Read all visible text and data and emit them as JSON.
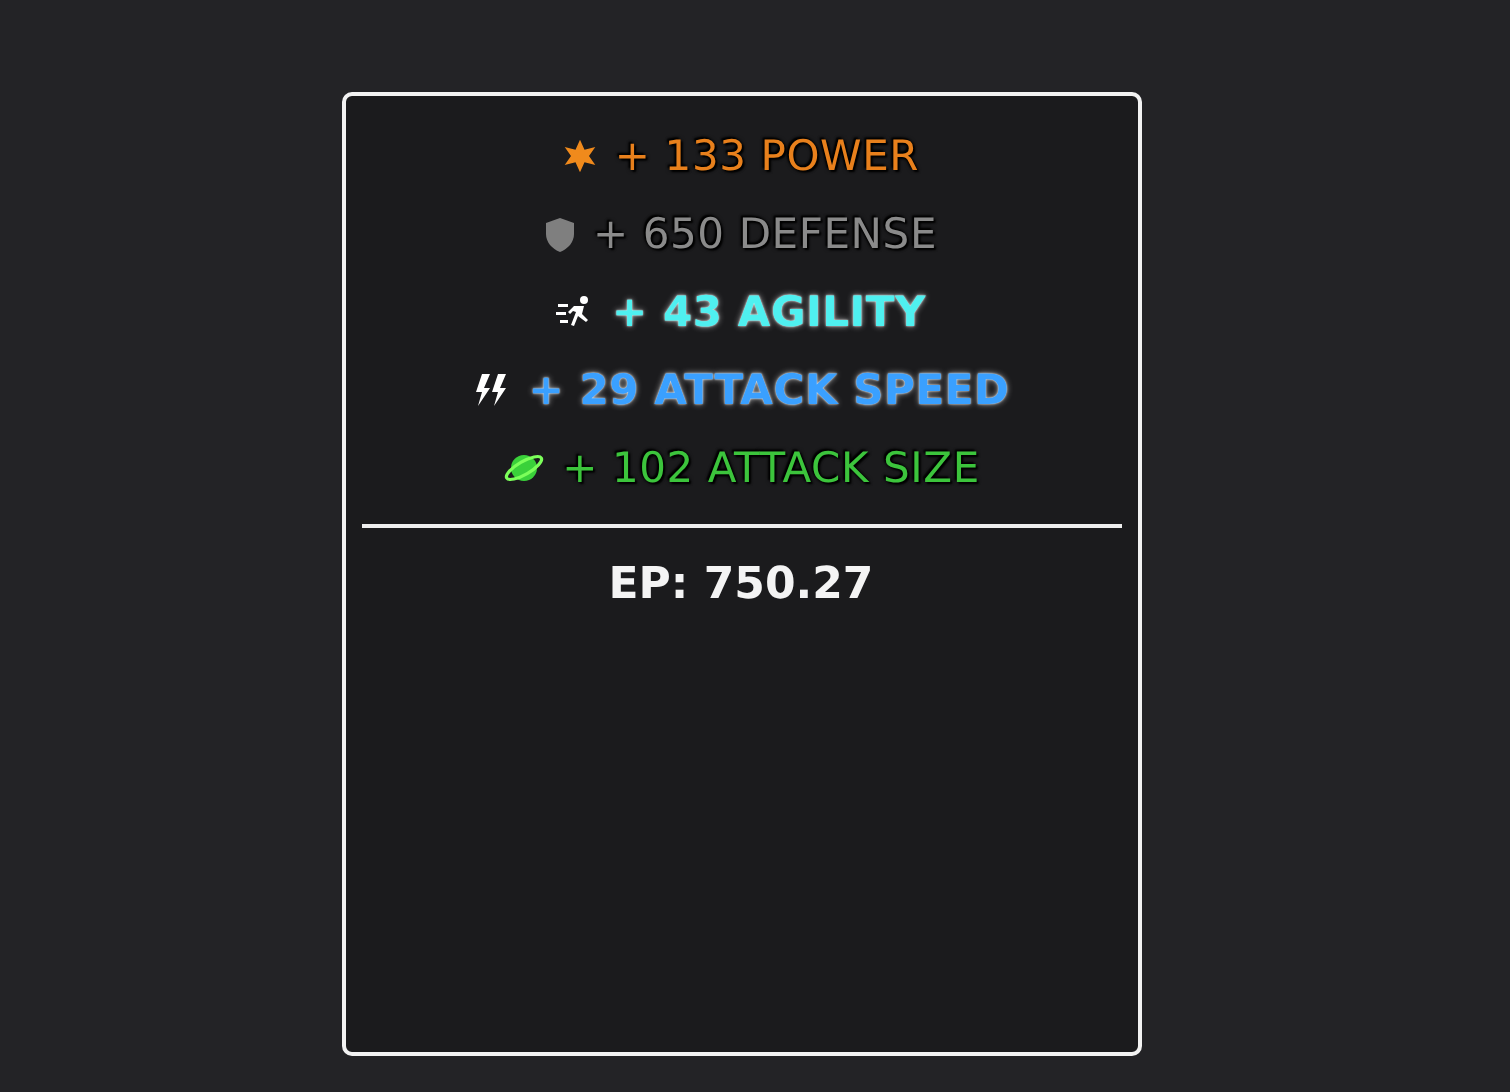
{
  "stats": [
    {
      "kind": "power",
      "text": "+ 133 POWER",
      "color": "#e8801c",
      "bold": false
    },
    {
      "kind": "defense",
      "text": "+ 650 DEFENSE",
      "color": "#8a8a8a",
      "bold": false
    },
    {
      "kind": "agility",
      "text": "+ 43 AGILITY",
      "color": "#4ff0f0",
      "bold": true
    },
    {
      "kind": "speed",
      "text": "+ 29 ATTACK SPEED",
      "color": "#3aa0ff",
      "bold": true
    },
    {
      "kind": "size",
      "text": "+ 102 ATTACK SIZE",
      "color": "#3cc43c",
      "bold": false
    }
  ],
  "ep": "EP: 750.27"
}
